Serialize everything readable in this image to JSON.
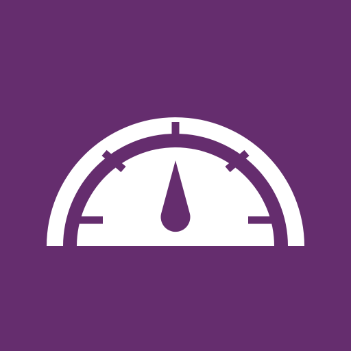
{
  "app_icon": {
    "icon": "speedometer-icon",
    "colors": {
      "background": "#652d6e",
      "foreground": "#ffffff"
    }
  }
}
